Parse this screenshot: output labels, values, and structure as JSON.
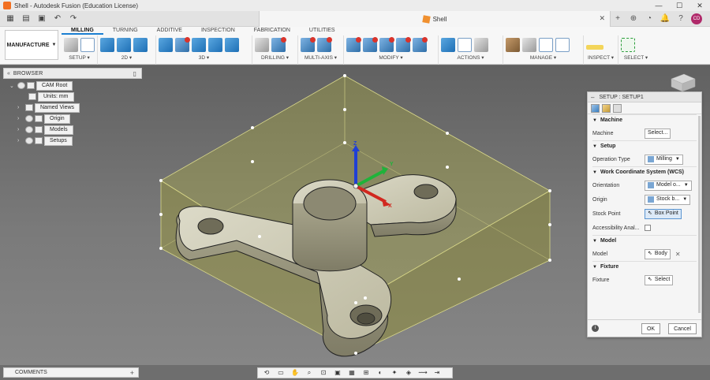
{
  "window": {
    "title": "Shell - Autodesk Fusion (Education License)"
  },
  "doc_tab": {
    "title": "Shell"
  },
  "user": {
    "initials": "CD"
  },
  "workspace": {
    "label": "MANUFACTURE"
  },
  "ribbon_tabs": [
    "MILLING",
    "TURNING",
    "ADDITIVE",
    "INSPECTION",
    "FABRICATION",
    "UTILITIES"
  ],
  "groups": {
    "setup": "SETUP ▾",
    "d2": "2D ▾",
    "d3": "3D ▾",
    "drilling": "DRILLING ▾",
    "multiaxis": "MULTI-AXIS ▾",
    "modify": "MODIFY ▾",
    "actions": "ACTIONS ▾",
    "manage": "MANAGE ▾",
    "inspect": "INSPECT ▾",
    "select": "SELECT ▾"
  },
  "browser": {
    "title": "BROWSER",
    "items": [
      "CAM Root",
      "Units: mm",
      "Named Views",
      "Origin",
      "Models",
      "Setups"
    ]
  },
  "setup_panel": {
    "title": "SETUP : SETUP1",
    "machine": {
      "section": "Machine",
      "label": "Machine",
      "button": "Select..."
    },
    "setup": {
      "section": "Setup",
      "op_type_label": "Operation Type",
      "op_type_value": "Milling"
    },
    "wcs": {
      "section": "Work Coordinate System (WCS)",
      "orientation_label": "Orientation",
      "orientation_value": "Model o...",
      "origin_label": "Origin",
      "origin_value": "Stock b...",
      "stock_point_label": "Stock Point",
      "stock_point_value": "Box Point",
      "accessibility_label": "Accessibility Anal..."
    },
    "model": {
      "section": "Model",
      "label": "Model",
      "value": "Body"
    },
    "fixture": {
      "section": "Fixture",
      "label": "Fixture",
      "value": "Select"
    },
    "ok": "OK",
    "cancel": "Cancel"
  },
  "comments": {
    "label": "COMMENTS"
  },
  "axes": {
    "x": "X",
    "y": "Y",
    "z": "Z"
  },
  "colors": {
    "accent": "#1b7fd1",
    "stock": "#b3b23f",
    "part": "#c9c7b0"
  }
}
